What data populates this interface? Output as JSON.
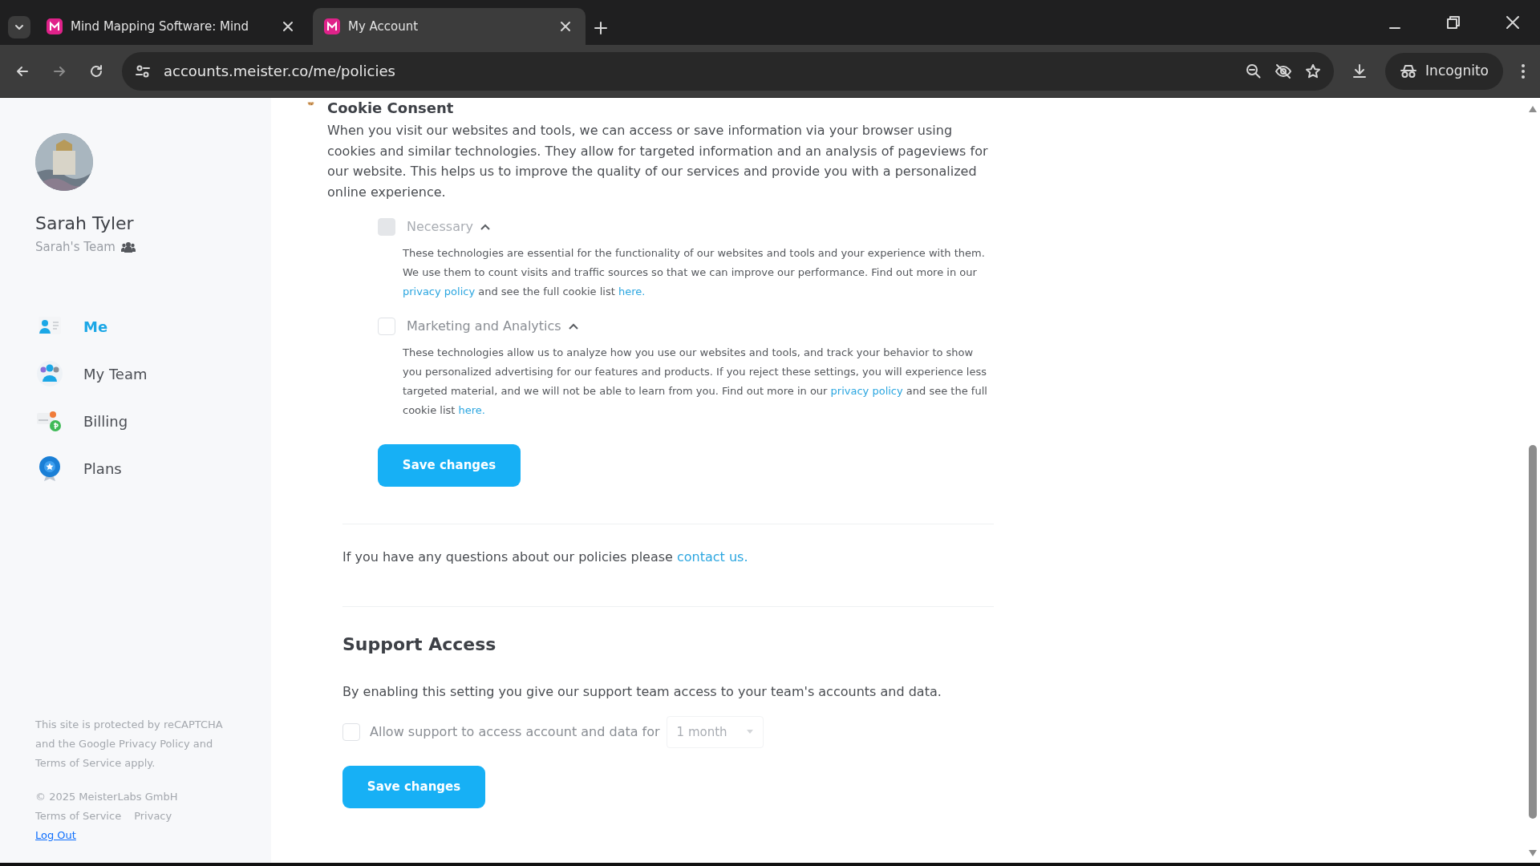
{
  "browser": {
    "tabs": [
      {
        "title": "Mind Mapping Software: Mind",
        "selected": false
      },
      {
        "title": "My Account",
        "selected": true
      }
    ],
    "url": "accounts.meister.co/me/policies",
    "profile": "Incognito"
  },
  "sidebar": {
    "user_name": "Sarah Tyler",
    "team": "Sarah's Team",
    "items": [
      {
        "label": "Me",
        "selected": true
      },
      {
        "label": "My Team",
        "selected": false
      },
      {
        "label": "Billing",
        "selected": false
      },
      {
        "label": "Plans",
        "selected": false
      }
    ],
    "recaptcha_note": "This site is protected by reCAPTCHA and the Google Privacy Policy and Terms of Service apply.",
    "copyright": "© 2025 MeisterLabs GmbH",
    "links": [
      "Terms of Service",
      "Privacy"
    ],
    "logout": "Log Out"
  },
  "cookie_consent": {
    "title": "Cookie Consent",
    "description": "When you visit our websites and tools, we can access or save information via your browser using cookies and similar technologies. They allow for targeted information and an analysis of pageviews for our website. This helps us to improve the quality of our services and provide you with a personalized online experience.",
    "categories": [
      {
        "label": "Necessary",
        "checked": false,
        "disabled": true,
        "expanded": true,
        "text": [
          {
            "kind": "text",
            "text": "These technologies are essential for the functionality of our websites and tools and your experience with them. We use them to count visits and traffic sources so that we can improve our performance. Find out more in our "
          },
          {
            "kind": "link",
            "text": "privacy policy"
          },
          {
            "kind": "text",
            "text": " and see the full cookie list "
          },
          {
            "kind": "link",
            "text": "here."
          }
        ]
      },
      {
        "label": "Marketing and Analytics",
        "checked": false,
        "disabled": false,
        "expanded": true,
        "text": [
          {
            "kind": "text",
            "text": "These technologies allow us to analyze how you use our websites and tools, and track your behavior to show you personalized advertising for our features and products. If you reject these settings, you will experience less targeted material, and we will not be able to learn from you. Find out more in our "
          },
          {
            "kind": "link",
            "text": "privacy policy"
          },
          {
            "kind": "text",
            "text": " and see the full cookie list "
          },
          {
            "kind": "link",
            "text": "here."
          }
        ]
      }
    ],
    "save_button": "Save changes"
  },
  "contact_note": [
    {
      "kind": "text",
      "text": "If you have any questions about our policies please "
    },
    {
      "kind": "link",
      "text": "contact us."
    }
  ],
  "support_access": {
    "title": "Support Access",
    "description": "By enabling this setting you give our support team access to your team's accounts and data.",
    "checkbox_label": "Allow support to access account and data for",
    "checked": false,
    "duration": {
      "value": "1 month",
      "disabled": true
    },
    "save_button": "Save changes"
  }
}
